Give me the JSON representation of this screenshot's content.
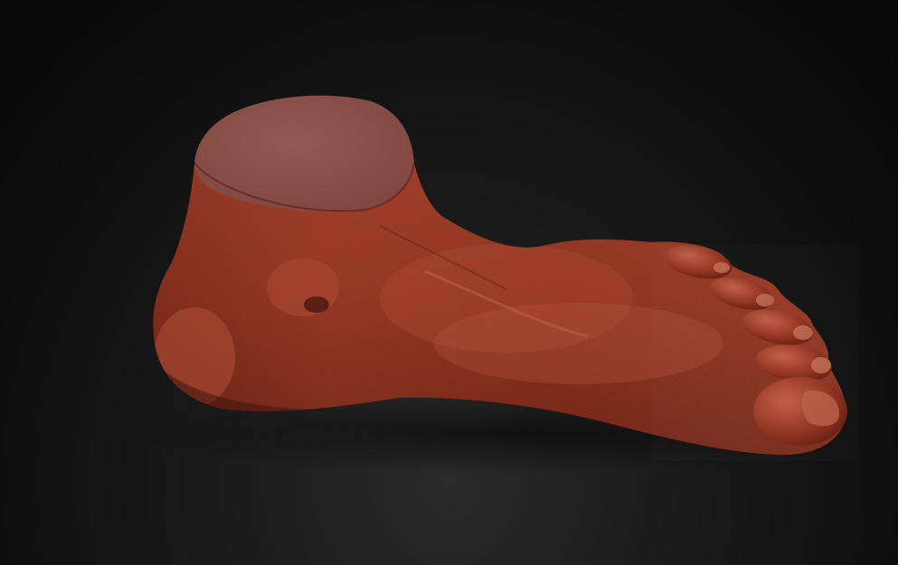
{
  "scene": {
    "background_color": "#111111",
    "model": {
      "subject": "foot",
      "material": {
        "base_color": "#8e2e1a",
        "highlight_color": "#c2644a",
        "shadow_color": "#4a1208",
        "cut_face_color": "#8e5048"
      }
    }
  }
}
